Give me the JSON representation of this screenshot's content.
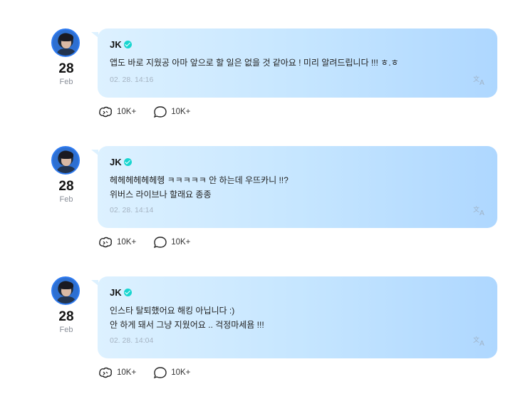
{
  "posts": [
    {
      "day": "28",
      "month": "Feb",
      "author": "JK",
      "lines": [
        "앱도 바로 지웠공 아마 앞으로 할 일은 없을 것 같아요 ! 미리 알려드립니다 !!! ㅎ.ㅎ"
      ],
      "time": "02. 28. 14:16",
      "likes": "10K+",
      "comments": "10K+"
    },
    {
      "day": "28",
      "month": "Feb",
      "author": "JK",
      "lines": [
        "헤헤헤헤헤헤헹 ㅋㅋㅋㅋㅋ 안 하는데 우뜨카니 !!?",
        "위버스 라이브나 할래요 종종"
      ],
      "time": "02. 28. 14:14",
      "likes": "10K+",
      "comments": "10K+"
    },
    {
      "day": "28",
      "month": "Feb",
      "author": "JK",
      "lines": [
        "인스타 탈퇴했어요 해킹 아닙니다 :)",
        "안 하게 돼서 그냥 지웠어요 .. 걱정마세욤 !!!"
      ],
      "time": "02. 28. 14:04",
      "likes": "10K+",
      "comments": "10K+"
    }
  ],
  "icons": {
    "verified": "verified-badge-icon",
    "translate": "translate-icon",
    "like": "like-icon",
    "comment": "comment-icon"
  },
  "colors": {
    "verified": "#19d6d0",
    "bubble_start": "#ddf1ff",
    "bubble_end": "#aed7ff",
    "timestamp": "#a5b3c2"
  }
}
